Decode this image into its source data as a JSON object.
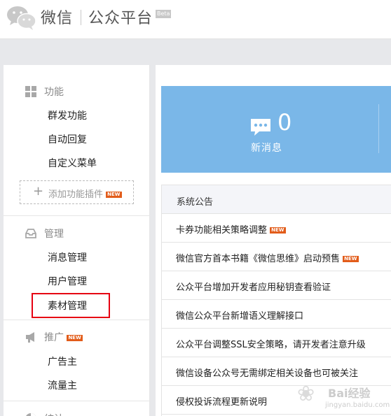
{
  "header": {
    "brand": "微信",
    "platform": "公众平台",
    "beta": "Beta"
  },
  "sidebar": {
    "function": {
      "title": "功能",
      "icon": "grid-icon",
      "items": [
        "群发功能",
        "自动回复",
        "自定义菜单"
      ],
      "add_plugin": "添加功能插件",
      "add_plugin_badge": "NEW"
    },
    "manage": {
      "title": "管理",
      "icon": "inbox-icon",
      "items": [
        "消息管理",
        "用户管理",
        "素材管理"
      ]
    },
    "promote": {
      "title": "推广",
      "icon": "megaphone-icon",
      "badge": "NEW",
      "items": [
        "广告主",
        "流量主"
      ]
    },
    "stats": {
      "title": "统计",
      "icon": "pie-chart-icon"
    }
  },
  "messages": {
    "count": "0",
    "label": "新消息",
    "icon": "chat-bubble-icon"
  },
  "notice": {
    "title": "系统公告",
    "items": [
      {
        "text": "卡券功能相关策略调整",
        "badge": "NEW"
      },
      {
        "text": "微信官方首本书籍《微信思维》启动预售",
        "badge": "NEW"
      },
      {
        "text": "公众平台增加开发者应用秘钥查看验证",
        "badge": ""
      },
      {
        "text": "微信公众平台新增语义理解接口",
        "badge": ""
      },
      {
        "text": "公众平台调整SSL安全策略，请开发者注意升级",
        "badge": ""
      },
      {
        "text": "微信设备公众号无需绑定相关设备也可被关注",
        "badge": ""
      },
      {
        "text": "侵权投诉流程更新说明",
        "badge": ""
      }
    ]
  },
  "watermark": {
    "text": "Bai经验",
    "url": "jingyan.baidu.com"
  },
  "colors": {
    "accent_blue": "#7ab7e8",
    "highlight_red": "#e60012",
    "new_badge": "#e25c1a"
  }
}
